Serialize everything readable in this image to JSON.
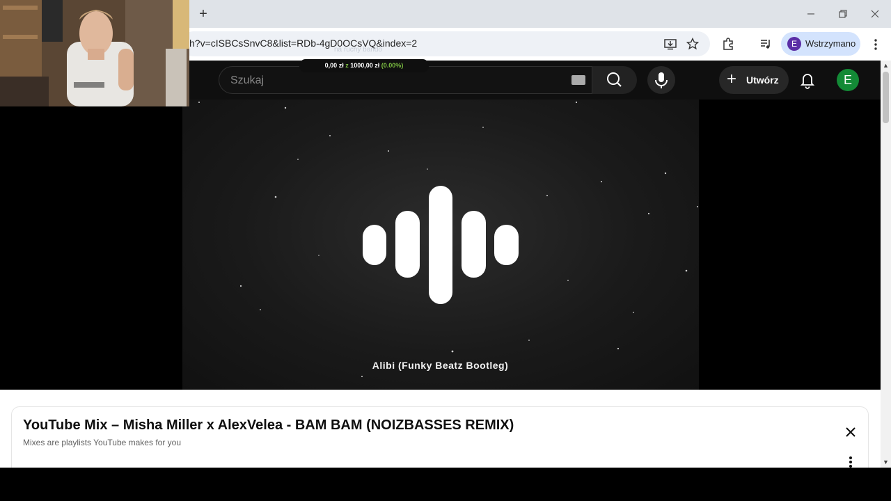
{
  "browser": {
    "new_tab_label": "+",
    "url": "h?v=cISBCsSnvC8&list=RDb-4gD0OCsVQ&index=2",
    "profile": {
      "initial": "E",
      "label": "Wstrzymano"
    },
    "overlay_ghost": "na ruchy bando",
    "overlay_amount": "0,00 zł",
    "overlay_of": "z",
    "overlay_total": "1000,00 zł",
    "overlay_percent": "(0.00%)"
  },
  "youtube": {
    "search_placeholder": "Szukaj",
    "create_label": "Utwórz",
    "avatar_initial": "E",
    "song_title": "Alibi (Funky Beatz Bootleg)",
    "mix": {
      "title": "YouTube Mix – Misha Miller x AlexVelea - BAM BAM (NOIZBASSES REMIX)",
      "subtitle": "Mixes are playlists YouTube makes for you"
    }
  },
  "colors": {
    "tabstrip": "#dfe3e8",
    "profile_pill": "#d3e3fd",
    "youtube_dark": "#0f0f0f",
    "avatar_green": "#138a36",
    "overlay_green": "#7ec243"
  },
  "icons": [
    "plus-icon",
    "minimize-icon",
    "restore-icon",
    "close-icon",
    "install-icon",
    "star-icon",
    "extensions-icon",
    "media-control-icon",
    "menu-icon",
    "keyboard-icon",
    "search-icon",
    "mic-icon",
    "bell-icon",
    "equalizer-logo-icon"
  ]
}
